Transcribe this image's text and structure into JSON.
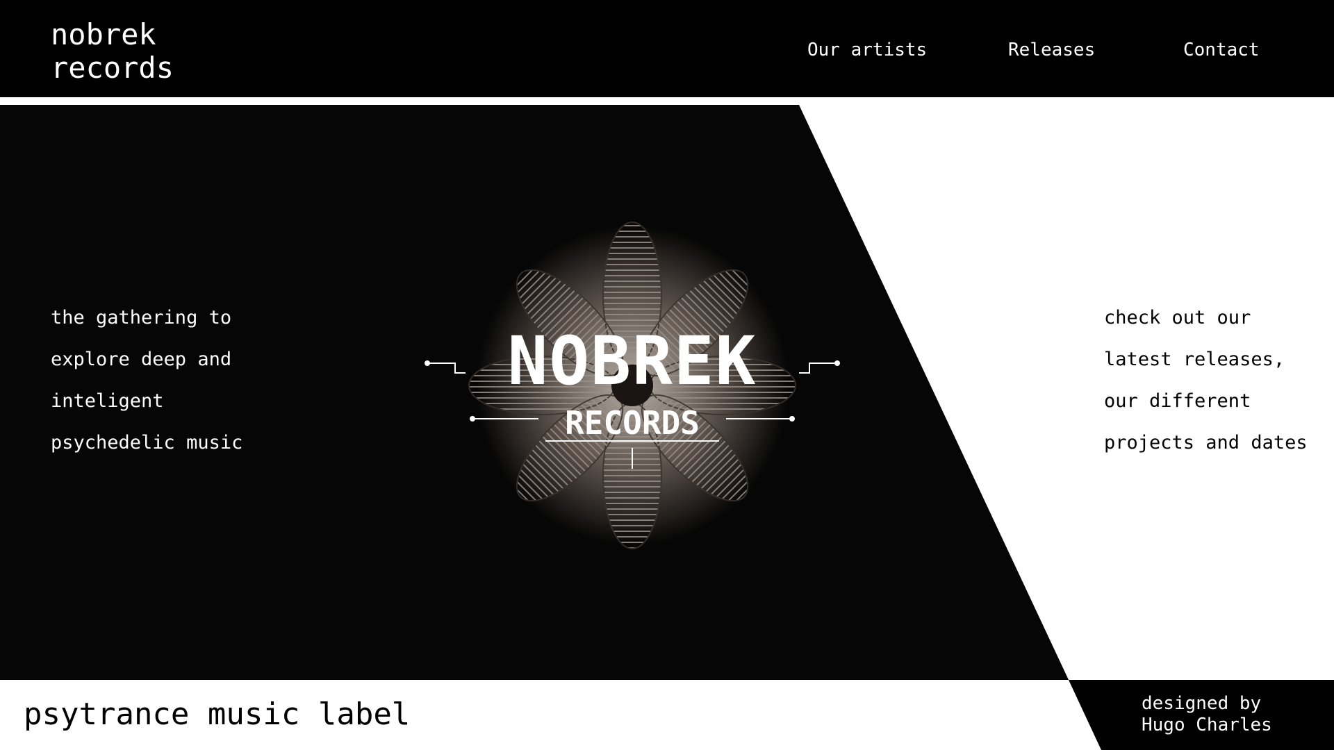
{
  "brand": {
    "line1": "nobrek",
    "line2": "records"
  },
  "nav": [
    {
      "label": "Our artists"
    },
    {
      "label": "Releases"
    },
    {
      "label": "Contact"
    }
  ],
  "hero": {
    "left_lines": [
      "the gathering to",
      "explore deep and",
      "inteligent",
      "psychedelic music"
    ],
    "right_lines": [
      "check out our",
      "latest releases,",
      "our different",
      "projects and dates"
    ],
    "emblem": {
      "title": "NOBREK",
      "subtitle": "RECORDS"
    }
  },
  "footer": {
    "tagline": "psytrance music label",
    "credit_line1": "designed by",
    "credit_line2": "Hugo Charles"
  },
  "colors": {
    "background": "#000000",
    "accent": "#ffffff",
    "emblem_metal": "#8a7d73"
  }
}
